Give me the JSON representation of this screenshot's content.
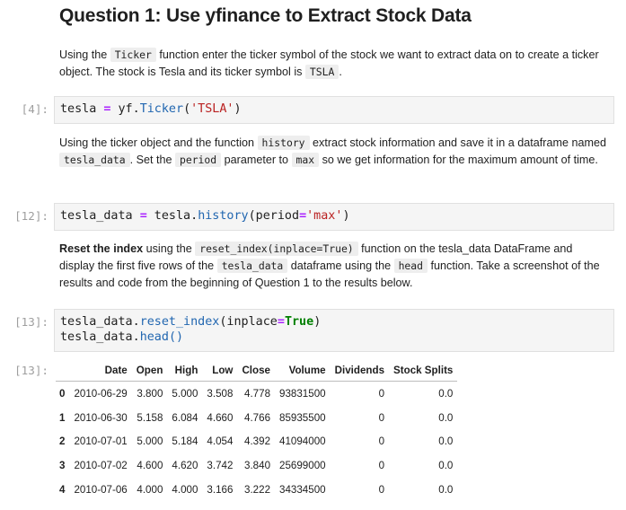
{
  "heading": "Question 1: Use yfinance to Extract Stock Data",
  "md1": {
    "t1": "Using the ",
    "c1": "Ticker",
    "t2": " function enter the ticker symbol of the stock we want to extract data on to create a ticker object. The stock is Tesla and its ticker symbol is ",
    "c2": "TSLA",
    "t3": "."
  },
  "cell4": {
    "prompt": "[4]:",
    "line": {
      "a": "tesla ",
      "b": "=",
      "c": " yf.",
      "d": "Ticker",
      "e": "(",
      "f": "'TSLA'",
      "g": ")"
    }
  },
  "md2": {
    "t1": "Using the ticker object and the function ",
    "c1": "history",
    "t2": " extract stock information and save it in a dataframe named ",
    "c2": "tesla_data",
    "t3": ". Set the ",
    "c3": "period",
    "t4": " parameter to ",
    "c4": "max",
    "t5": " so we get information for the maximum amount of time."
  },
  "cell12": {
    "prompt": "[12]:",
    "line": {
      "a": "tesla_data ",
      "b": "=",
      "c": " tesla.",
      "d": "history",
      "e": "(period",
      "f": "=",
      "g": "'max'",
      "h": ")"
    }
  },
  "md3": {
    "bold": "Reset the index",
    "t1": " using the ",
    "c1": "reset_index(inplace=True)",
    "t2": " function on the tesla_data DataFrame and display the first five rows of the ",
    "c2": "tesla_data",
    "t3": " dataframe using the ",
    "c3": "head",
    "t4": " function. Take a screenshot of the results and code from the beginning of Question 1 to the results below."
  },
  "cell13": {
    "prompt": "[13]:",
    "line1": {
      "a": "tesla_data.",
      "b": "reset_index",
      "c": "(inplace",
      "d": "=",
      "e": "True",
      "f": ")"
    },
    "line2": {
      "a": "tesla_data.",
      "b": "head",
      "c": "()"
    }
  },
  "out13": {
    "prompt": "[13]:",
    "columns": [
      "",
      "Date",
      "Open",
      "High",
      "Low",
      "Close",
      "Volume",
      "Dividends",
      "Stock Splits"
    ],
    "rows": [
      [
        "0",
        "2010-06-29",
        "3.800",
        "5.000",
        "3.508",
        "4.778",
        "93831500",
        "0",
        "0.0"
      ],
      [
        "1",
        "2010-06-30",
        "5.158",
        "6.084",
        "4.660",
        "4.766",
        "85935500",
        "0",
        "0.0"
      ],
      [
        "2",
        "2010-07-01",
        "5.000",
        "5.184",
        "4.054",
        "4.392",
        "41094000",
        "0",
        "0.0"
      ],
      [
        "3",
        "2010-07-02",
        "4.600",
        "4.620",
        "3.742",
        "3.840",
        "25699000",
        "0",
        "0.0"
      ],
      [
        "4",
        "2010-07-06",
        "4.000",
        "4.000",
        "3.166",
        "3.222",
        "34334500",
        "0",
        "0.0"
      ]
    ]
  }
}
